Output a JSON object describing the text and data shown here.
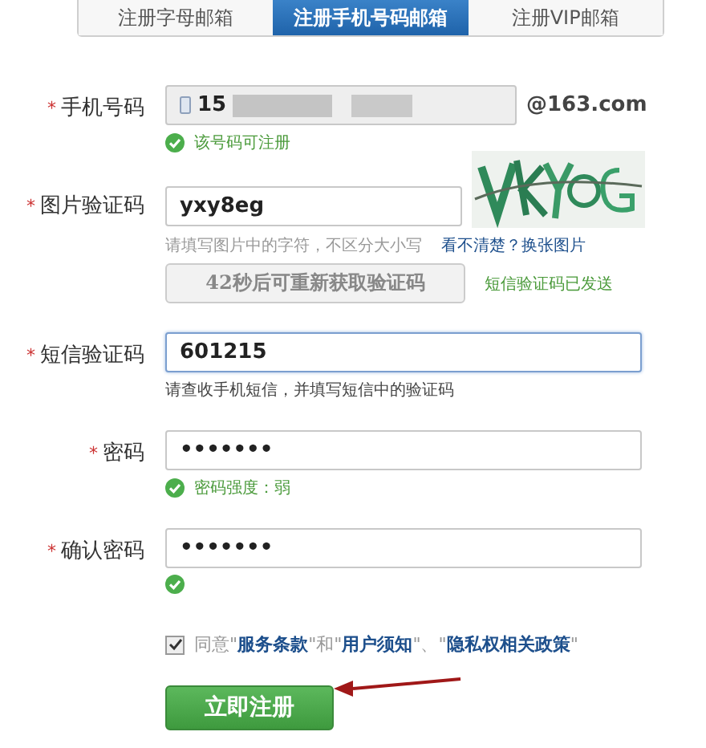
{
  "tabs": [
    {
      "label": "注册字母邮箱",
      "selected": false
    },
    {
      "label": "注册手机号码邮箱",
      "selected": true
    },
    {
      "label": "注册VIP邮箱",
      "selected": false
    }
  ],
  "rows": [
    {
      "kind": "phone",
      "label": "手机号码",
      "mark": "*",
      "value": "15",
      "redacted": true,
      "suffix": "@163.com",
      "notes": [
        {
          "kind": "ok",
          "text": "该号码可注册"
        }
      ]
    },
    {
      "kind": "captcha",
      "label": "图片验证码",
      "mark": "*",
      "value": "yxy8eg",
      "hint": "请填写图片中的字符，不区分大小写",
      "link": "看不清楚？换张图片",
      "resend": {
        "label": "42秒后可重新获取验证码",
        "disabled": true
      },
      "status": "短信验证码已发送"
    },
    {
      "kind": "text",
      "label": "短信验证码",
      "mark": "*",
      "value": "601215",
      "focused": true,
      "notes": [
        {
          "kind": "info",
          "text": "请查收手机短信，并填写短信中的验证码"
        }
      ]
    },
    {
      "kind": "text",
      "label": "密码",
      "mark": "*",
      "value": "•••••••",
      "focused": false,
      "notes": [
        {
          "kind": "ok",
          "text": "密码强度：弱"
        }
      ]
    },
    {
      "kind": "text",
      "label": "确认密码",
      "mark": "*",
      "value": "•••••••",
      "focused": false,
      "notes": [
        {
          "kind": "ok"
        }
      ]
    }
  ],
  "agreement": {
    "checked": true,
    "parts": [
      {
        "kind": "plain",
        "text": "同意\""
      },
      {
        "kind": "link",
        "text": "服务条款"
      },
      {
        "kind": "plain",
        "text": "\"和\""
      },
      {
        "kind": "link",
        "text": "用户须知"
      },
      {
        "kind": "plain",
        "text": "\"、\""
      },
      {
        "kind": "link",
        "text": "隐私权相关政策"
      },
      {
        "kind": "plain",
        "text": "\""
      }
    ]
  },
  "submit": {
    "label": "立即注册"
  }
}
